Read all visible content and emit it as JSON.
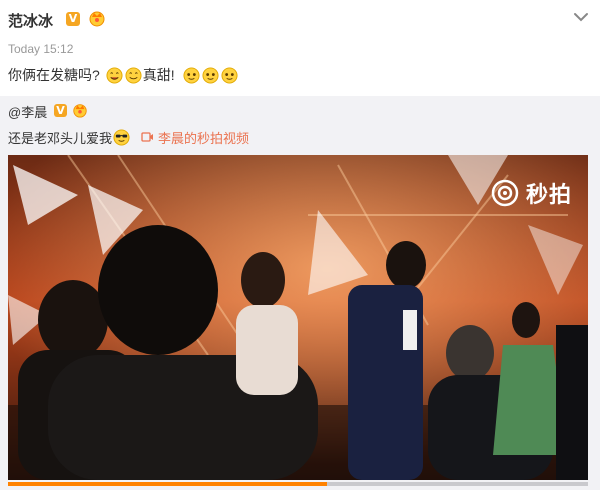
{
  "post": {
    "username": "范冰冰",
    "timestamp": "Today 15:12",
    "text_part1": "你俩在发糖吗?",
    "text_part2": "真甜!"
  },
  "repost": {
    "author": "@李晨",
    "text": "还是老邓头儿爱我",
    "video_link_label": "李晨的秒拍视频"
  },
  "video": {
    "watermark": "秒拍",
    "progress_fraction": 0.55
  },
  "colors": {
    "link": "#eb7350",
    "verified_badge": "#f5a623",
    "progress": "#ff8200"
  },
  "icons": [
    "verified-badge-icon",
    "crown-icon",
    "chevron-down-icon",
    "smile-emoji-icon",
    "wink-emoji-icon",
    "sunglasses-emoji-icon",
    "video-link-icon",
    "miaopai-logo-icon"
  ]
}
